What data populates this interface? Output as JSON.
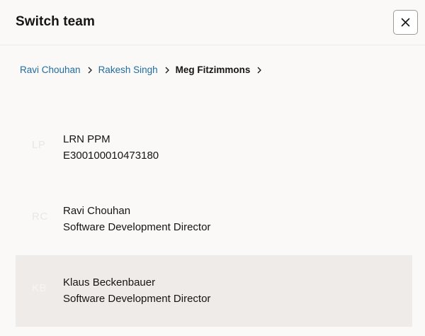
{
  "dialog": {
    "title": "Switch team",
    "close_icon": "close-icon"
  },
  "breadcrumb": {
    "items": [
      {
        "label": "Ravi Chouhan",
        "link": true
      },
      {
        "label": "Rakesh Singh",
        "link": true
      },
      {
        "label": "Meg Fitzimmons",
        "link": false
      }
    ],
    "separator_icon": "chevron-right-icon"
  },
  "members": [
    {
      "initials": "LP",
      "name": "LRN PPM",
      "subtitle": "E300100010473180",
      "selected": false
    },
    {
      "initials": "RC",
      "name": "Ravi Chouhan",
      "subtitle": "Software Development Director",
      "selected": false
    },
    {
      "initials": "KB",
      "name": "Klaus Beckenbauer",
      "subtitle": "Software Development Director",
      "selected": true
    }
  ],
  "colors": {
    "link": "#1f6c9e",
    "selected_row": "#eeebe9",
    "background": "#fbf9f8"
  }
}
